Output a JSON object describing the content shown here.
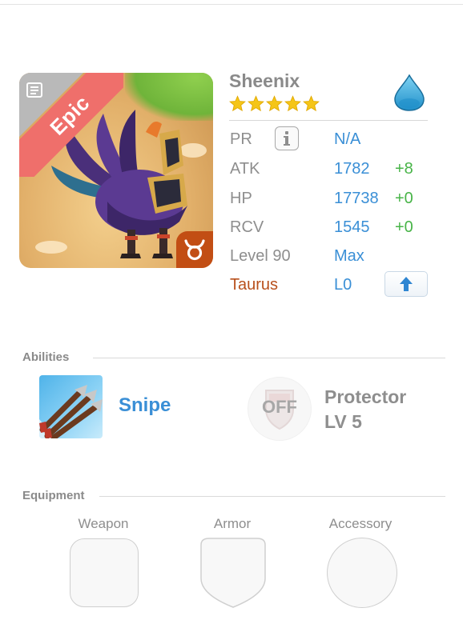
{
  "creature": {
    "name": "Sheenix",
    "stars": 5,
    "rarity": "Epic",
    "element_icon": "water-drop-icon",
    "zodiac_icon": "taurus-icon"
  },
  "stats": [
    {
      "label": "PR",
      "value": "N/A",
      "bonus": "",
      "control": "info-button"
    },
    {
      "label": "ATK",
      "value": "1782",
      "bonus": "+8"
    },
    {
      "label": "HP",
      "value": "17738",
      "bonus": "+0"
    },
    {
      "label": "RCV",
      "value": "1545",
      "bonus": "+0"
    },
    {
      "label": "Level 90",
      "value": "Max",
      "bonus": ""
    },
    {
      "label": "Taurus",
      "value": "L0",
      "bonus": "",
      "control": "upgrade-button"
    }
  ],
  "abilities": {
    "title": "Abilities",
    "active": {
      "name": "Snipe",
      "icon": "snipe-arrows-icon"
    },
    "passive": {
      "status": "OFF",
      "name": "Protector",
      "level": "LV 5",
      "icon": "shield-icon"
    }
  },
  "equipment": {
    "title": "Equipment",
    "slots": [
      {
        "label": "Weapon"
      },
      {
        "label": "Armor"
      },
      {
        "label": "Accessory"
      }
    ]
  },
  "colors": {
    "accent_blue": "#3a8fd6",
    "bonus_green": "#48b448",
    "zodiac_orange": "#b8501c",
    "epic_ribbon": "#ef6f6b",
    "star_gold": "#f5c518"
  }
}
